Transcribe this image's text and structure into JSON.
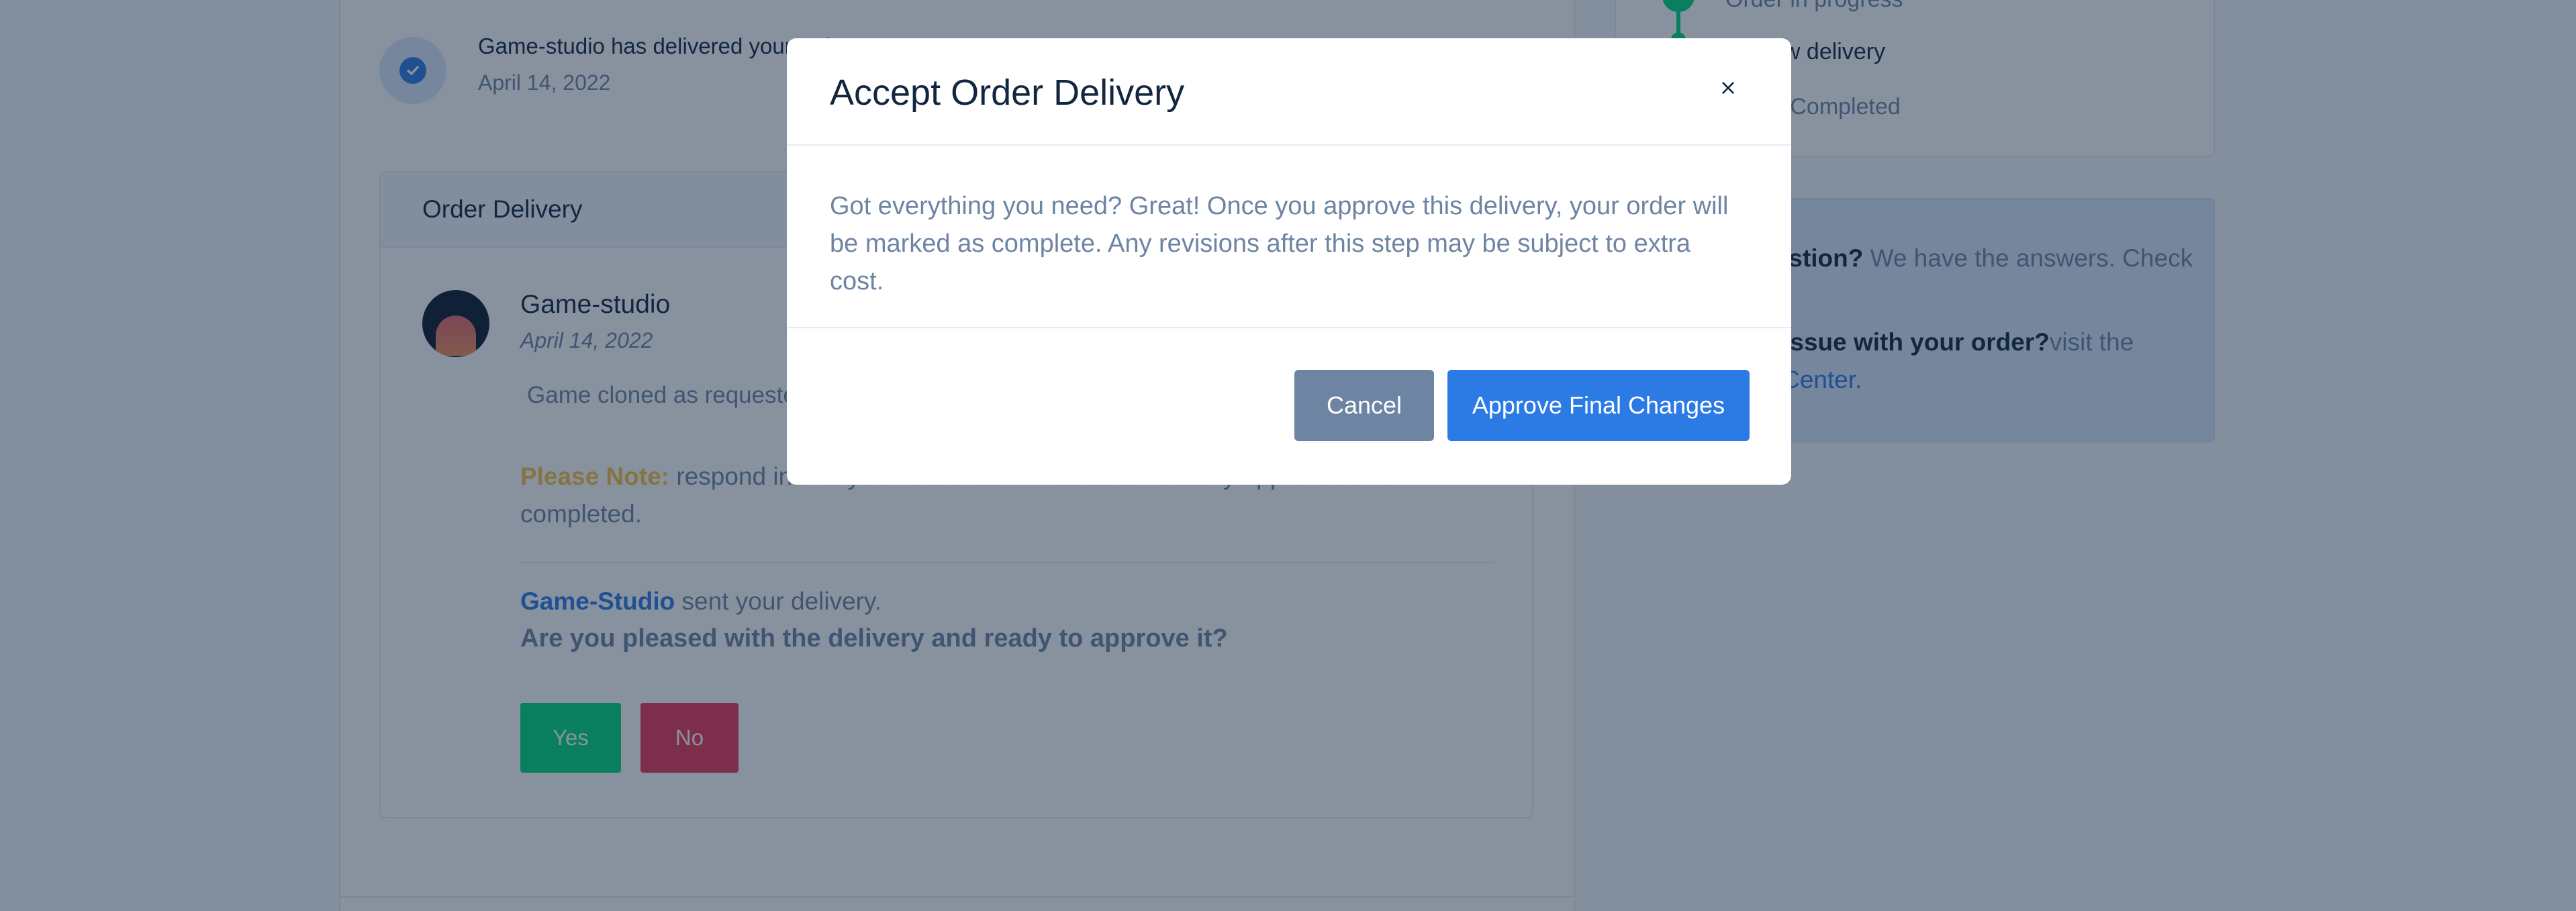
{
  "timeline": {
    "entry_text": "Game-studio has delivered your order",
    "entry_date": "April 14, 2022"
  },
  "delivery": {
    "title": "Order Delivery",
    "sender": "Game-studio",
    "date": "April 14, 2022",
    "message": "Game cloned as requested",
    "note_label": "Please Note:",
    "note_text": " respond in 3 days or the order will be automatically approved and completed.",
    "sent_by": "Game-Studio",
    "sent_suffix": " sent your delivery.",
    "question": "Are you pleased with the delivery and ready to approve it?",
    "yes_label": "Yes",
    "no_label": "No"
  },
  "sidebar": {
    "steps": [
      {
        "label": "Order in progress"
      },
      {
        "label": "Review delivery"
      },
      {
        "label": "Order Completed"
      }
    ],
    "help": {
      "question_bold": "Have a question?",
      "question_text": " We have the answers. Check our FAQ.",
      "issue_bold": "Having an issue with your order?",
      "issue_text": "visit the",
      "issue_link": "Resolution Center."
    }
  },
  "modal": {
    "title": "Accept Order Delivery",
    "close_label": "×",
    "body": " Got everything you need? Great! Once you approve this delivery, your order will be marked as complete. Any revisions after this step may be subject to extra cost.",
    "cancel_label": "Cancel",
    "approve_label": "Approve Final Changes"
  },
  "colors": {
    "primary": "#2c7be5",
    "success": "#00d97e",
    "danger": "#e63757",
    "warning": "#f6c343",
    "muted": "#6e84a3",
    "heading": "#12263f"
  }
}
